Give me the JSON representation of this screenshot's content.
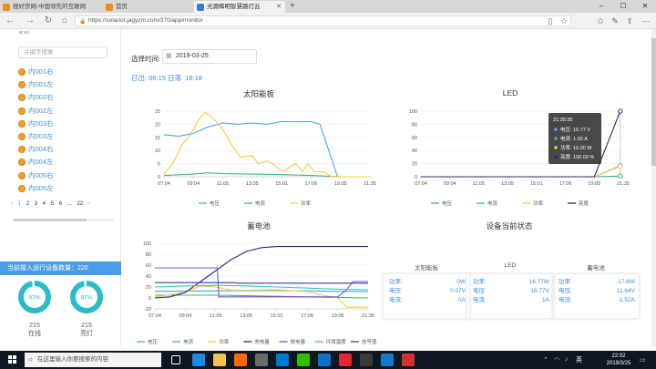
{
  "browser": {
    "tabs": [
      {
        "label": "搜好货网-中国领先的互联网",
        "color": "#f08c1e",
        "active": false
      },
      {
        "label": "首页",
        "color": "#f08c1e",
        "active": false
      },
      {
        "label": "光源辉明智慧路灯云",
        "color": "#3a7bd5",
        "active": true
      }
    ],
    "new_tab": "+",
    "url": "https://solariot.jagyzm.com/370/app/monitor"
  },
  "sidebar": {
    "search_placeholder": "关键字搜索",
    "top_cut": "名称",
    "devices": [
      "内001右",
      "内001左",
      "内002右",
      "内002左",
      "内003右",
      "内003左",
      "内004右",
      "内004左",
      "内005右",
      "内005左"
    ],
    "pager": {
      "prev": "‹",
      "pages": [
        "1",
        "2",
        "3",
        "4",
        "5",
        "6",
        "...",
        "22"
      ],
      "next": "›",
      "current": "1"
    },
    "count_label": "当前接入运行设备数量：220",
    "gauges": [
      {
        "percent_text": "97%",
        "value": 97,
        "count": "215",
        "label": "在线"
      },
      {
        "percent_text": "97%",
        "value": 97,
        "count": "215",
        "label": "亮灯"
      }
    ]
  },
  "main": {
    "date_label": "选择时间:",
    "date_value": "2019-03-25",
    "sun_times": "日出: 06:15 日落: 18:18",
    "status": {
      "title": "设备当前状态",
      "columns": [
        {
          "title": "太阳能板",
          "rows": [
            {
              "k": "功率:",
              "v": "0W"
            },
            {
              "k": "电压:",
              "v": "0.07V"
            },
            {
              "k": "电流:",
              "v": "0A"
            }
          ]
        },
        {
          "title": "LED",
          "rows": [
            {
              "k": "功率:",
              "v": "16.77W"
            },
            {
              "k": "电压:",
              "v": "16.77V"
            },
            {
              "k": "电流:",
              "v": "1A"
            }
          ]
        },
        {
          "title": "蓄电池",
          "rows": [
            {
              "k": "功率:",
              "v": "-17.6W"
            },
            {
              "k": "电压:",
              "v": "11.64V"
            },
            {
              "k": "电流:",
              "v": "-1.52A"
            }
          ]
        }
      ]
    }
  },
  "chart_data": [
    {
      "id": "solar",
      "type": "line",
      "title": "太阳能板",
      "categories": [
        "07:04",
        "09:04",
        "11:05",
        "13:05",
        "15:01",
        "17:06",
        "19:05",
        "21:35"
      ],
      "ylim": [
        0,
        25
      ],
      "yticks": [
        0,
        5,
        10,
        15,
        20,
        25
      ],
      "grid": true,
      "legend_position": "bottom",
      "series": [
        {
          "name": "电压",
          "color": "#4aa3e8",
          "points": [
            [
              0,
              16
            ],
            [
              0.5,
              15.5
            ],
            [
              1,
              16.5
            ],
            [
              1.5,
              19
            ],
            [
              2,
              20.5
            ],
            [
              2.5,
              20
            ],
            [
              3,
              20.5
            ],
            [
              3.5,
              20
            ],
            [
              4,
              21
            ],
            [
              4.5,
              21
            ],
            [
              5,
              21
            ],
            [
              5.3,
              20
            ],
            [
              5.6,
              10
            ],
            [
              5.9,
              0
            ],
            [
              6.5,
              0
            ],
            [
              7,
              0
            ]
          ]
        },
        {
          "name": "电流",
          "color": "#3cb878",
          "points": [
            [
              0,
              0.5
            ],
            [
              1,
              1
            ],
            [
              1.5,
              1.5
            ],
            [
              2,
              1.2
            ],
            [
              3,
              1
            ],
            [
              4,
              0.8
            ],
            [
              5,
              0.5
            ],
            [
              6,
              0
            ],
            [
              7,
              0
            ]
          ]
        },
        {
          "name": "功率",
          "color": "#f7ca3b",
          "points": [
            [
              0,
              1
            ],
            [
              0.3,
              5
            ],
            [
              0.6,
              12
            ],
            [
              0.9,
              16
            ],
            [
              1.2,
              22
            ],
            [
              1.4,
              24.5
            ],
            [
              1.7,
              22
            ],
            [
              2,
              18
            ],
            [
              2.3,
              12
            ],
            [
              2.6,
              7.5
            ],
            [
              3,
              8
            ],
            [
              3.2,
              5
            ],
            [
              3.5,
              6
            ],
            [
              3.7,
              5
            ],
            [
              3.9,
              3
            ],
            [
              4.1,
              2
            ],
            [
              4.3,
              4
            ],
            [
              4.5,
              5
            ],
            [
              4.7,
              2
            ],
            [
              4.9,
              5
            ],
            [
              5.1,
              2
            ],
            [
              5.4,
              2
            ],
            [
              5.7,
              0
            ],
            [
              6,
              0
            ],
            [
              7,
              0
            ]
          ]
        }
      ]
    },
    {
      "id": "led",
      "type": "line",
      "title": "LED",
      "categories": [
        "07:04",
        "09:04",
        "11:05",
        "13:05",
        "15:01",
        "17:06",
        "19:05",
        "21:35"
      ],
      "ylim": [
        0,
        100
      ],
      "yticks": [
        0,
        20,
        40,
        60,
        80,
        100
      ],
      "grid": true,
      "legend_position": "bottom",
      "series": [
        {
          "name": "电压",
          "color": "#4aa3e8",
          "points": [
            [
              0,
              0
            ],
            [
              6,
              0
            ],
            [
              6.9,
              16.77
            ]
          ]
        },
        {
          "name": "电流",
          "color": "#3cb878",
          "points": [
            [
              0,
              0
            ],
            [
              6,
              0
            ],
            [
              6.9,
              1
            ]
          ]
        },
        {
          "name": "功率",
          "color": "#f7ca3b",
          "points": [
            [
              0,
              0
            ],
            [
              6,
              0
            ],
            [
              6.9,
              16
            ]
          ]
        },
        {
          "name": "亮度",
          "color": "#2a2a78",
          "points": [
            [
              0,
              0
            ],
            [
              6,
              0
            ],
            [
              6.9,
              100
            ]
          ]
        }
      ],
      "tooltip": {
        "time": "21:35:35",
        "rows": [
          {
            "label": "电压: 16.77 V",
            "color": "#4aa3e8"
          },
          {
            "label": "电流: 1.00 A",
            "color": "#3cb878"
          },
          {
            "label": "功率: 16.00 W",
            "color": "#f7ca3b"
          },
          {
            "label": "亮度: 100.00 %",
            "color": "#2a2a78"
          }
        ]
      }
    },
    {
      "id": "battery",
      "type": "line",
      "title": "蓄电池",
      "categories": [
        "07:04",
        "09:04",
        "11:05",
        "13:05",
        "15:01",
        "17:06",
        "19:05",
        "21:35"
      ],
      "ylim": [
        -20,
        100
      ],
      "yticks": [
        -20,
        0,
        20,
        40,
        60,
        80,
        100
      ],
      "grid": true,
      "legend_position": "bottom",
      "series": [
        {
          "name": "电压",
          "color": "#4aa3e8",
          "points": [
            [
              0,
              12
            ],
            [
              2,
              13
            ],
            [
              4,
              13.5
            ],
            [
              5,
              13
            ],
            [
              6,
              12
            ],
            [
              7,
              12
            ]
          ]
        },
        {
          "name": "电流",
          "color": "#3cb878",
          "points": [
            [
              0,
              5
            ],
            [
              2,
              5
            ],
            [
              4,
              3
            ],
            [
              6,
              1
            ],
            [
              7,
              0
            ]
          ]
        },
        {
          "name": "功率",
          "color": "#f7ca3b",
          "points": [
            [
              0,
              2
            ],
            [
              1,
              10
            ],
            [
              1.5,
              22
            ],
            [
              2,
              20
            ],
            [
              2.5,
              14
            ],
            [
              3,
              14
            ],
            [
              4,
              15
            ],
            [
              5,
              12
            ],
            [
              5.5,
              5
            ],
            [
              6,
              0
            ],
            [
              6.3,
              -17
            ],
            [
              7,
              -17
            ]
          ]
        },
        {
          "name": "充电量",
          "color": "#2a2a78",
          "points": [
            [
              0,
              0
            ],
            [
              0.5,
              2
            ],
            [
              1,
              10
            ],
            [
              1.5,
              30
            ],
            [
              2,
              50
            ],
            [
              2.5,
              70
            ],
            [
              3,
              85
            ],
            [
              3.5,
              92
            ],
            [
              4,
              94
            ],
            [
              7,
              94
            ]
          ]
        },
        {
          "name": "放电量",
          "color": "#7a52cc",
          "points": [
            [
              0,
              55
            ],
            [
              2.05,
              55
            ],
            [
              2.1,
              2
            ],
            [
              6,
              2
            ],
            [
              6.3,
              15
            ],
            [
              6.5,
              30
            ],
            [
              7,
              30
            ]
          ]
        },
        {
          "name": "环境温度",
          "color": "#36c6c6",
          "points": [
            [
              0,
              20
            ],
            [
              1,
              22
            ],
            [
              2,
              23
            ],
            [
              3,
              22
            ],
            [
              4,
              20
            ],
            [
              5,
              18
            ],
            [
              6,
              16
            ],
            [
              7,
              15
            ]
          ]
        },
        {
          "name": "信号值",
          "color": "#3a3aa0",
          "points": [
            [
              0,
              28
            ],
            [
              2.6,
              28
            ],
            [
              2.7,
              27
            ],
            [
              7,
              27
            ]
          ]
        }
      ]
    }
  ],
  "taskbar": {
    "search_placeholder": "在这里输入你要搜索的内容",
    "ime": "英",
    "time": "22:02",
    "date": "2019/3/25",
    "apps": [
      {
        "name": "task-view",
        "color": "#ffffff"
      },
      {
        "name": "edge",
        "color": "#1e88e5"
      },
      {
        "name": "folder",
        "color": "#f2c14e"
      },
      {
        "name": "xiaomi",
        "color": "#ff6a00"
      },
      {
        "name": "store",
        "color": "#6b6b6b"
      },
      {
        "name": "photos",
        "color": "#0078d4"
      },
      {
        "name": "wechat",
        "color": "#2dc100"
      },
      {
        "name": "mail",
        "color": "#0a72c9"
      },
      {
        "name": "app-red",
        "color": "#e0282e"
      },
      {
        "name": "app-bag",
        "color": "#3a3a3a"
      },
      {
        "name": "app-blue",
        "color": "#1678c8"
      },
      {
        "name": "app-red2",
        "color": "#d0312d"
      }
    ]
  }
}
